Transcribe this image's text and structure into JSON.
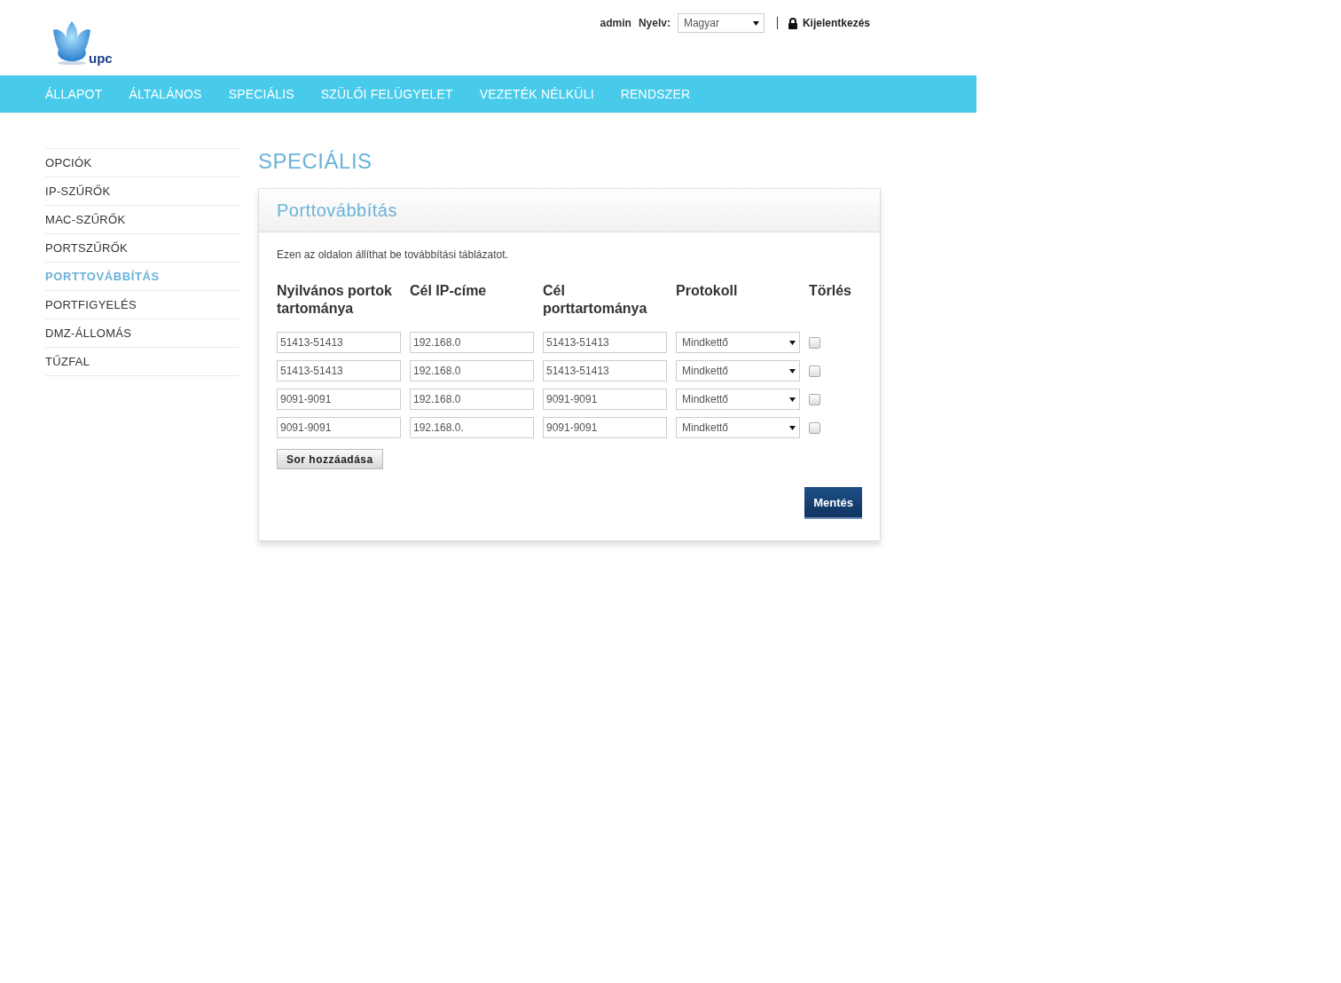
{
  "header": {
    "logo_text": "upc",
    "user": "admin",
    "language_label": "Nyelv:",
    "language_value": "Magyar",
    "logout": "Kijelentkezés"
  },
  "nav": [
    {
      "label": "ÁLLAPOT"
    },
    {
      "label": "ÁLTALÁNOS"
    },
    {
      "label": "SPECIÁLIS"
    },
    {
      "label": "SZÜLŐI FELÜGYELET"
    },
    {
      "label": "VEZETÉK NÉLKÜLI"
    },
    {
      "label": "RENDSZER"
    }
  ],
  "sidebar": {
    "items": [
      {
        "label": "OPCIÓK",
        "selected": false
      },
      {
        "label": "IP-SZŰRŐK",
        "selected": false
      },
      {
        "label": "MAC-SZŰRŐK",
        "selected": false
      },
      {
        "label": "PORTSZŰRŐK",
        "selected": false
      },
      {
        "label": "PORTTOVÁBBÍTÁS",
        "selected": true
      },
      {
        "label": "PORTFIGYELÉS",
        "selected": false
      },
      {
        "label": "DMZ-ÁLLOMÁS",
        "selected": false
      },
      {
        "label": "TŰZFAL",
        "selected": false
      }
    ]
  },
  "page_title": "SPECIÁLIS",
  "card": {
    "title": "Porttovábbítás",
    "description": "Ezen az oldalon állíthat be továbbítási táblázatot.",
    "columns": [
      "Nyilvános portok tartománya",
      "Cél IP-címe",
      "Cél porttartománya",
      "Protokoll",
      "Törlés"
    ],
    "rows": [
      {
        "public_ports": "51413-51413",
        "target_ip": "192.168.0",
        "target_ports": "51413-51413",
        "protocol": "Mindkettő",
        "delete": false
      },
      {
        "public_ports": "51413-51413",
        "target_ip": "192.168.0",
        "target_ports": "51413-51413",
        "protocol": "Mindkettő",
        "delete": false
      },
      {
        "public_ports": "9091-9091",
        "target_ip": "192.168.0",
        "target_ports": "9091-9091",
        "protocol": "Mindkettő",
        "delete": false
      },
      {
        "public_ports": "9091-9091",
        "target_ip": "192.168.0.",
        "target_ports": "9091-9091",
        "protocol": "Mindkettő",
        "delete": false
      }
    ],
    "add_row_button": "Sor hozzáadása",
    "save_button": "Mentés"
  }
}
